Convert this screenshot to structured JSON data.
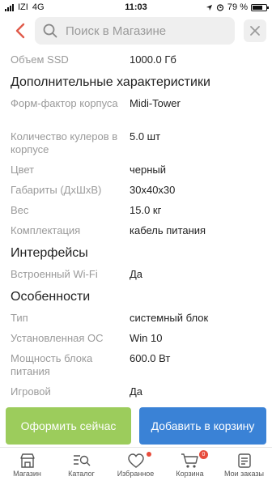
{
  "status_bar": {
    "carrier": "IZI",
    "network": "4G",
    "time": "11:03",
    "battery": "79 %",
    "battery_level": 0.79
  },
  "search": {
    "placeholder": "Поиск в Магазине"
  },
  "specs": {
    "top_row": {
      "key": "Объем SSD",
      "value": "1000.0 Гб"
    },
    "additional": {
      "title": "Дополнительные характеристики",
      "rows": [
        {
          "key": "Форм-фактор корпуса",
          "value": "Midi-Tower"
        },
        {
          "key": "Количество кулеров в корпусе",
          "value": "5.0 шт"
        },
        {
          "key": "Цвет",
          "value": "черный"
        },
        {
          "key": "Габариты (ДхШхВ)",
          "value": "30х40х30"
        },
        {
          "key": "Вес",
          "value": "15.0 кг"
        },
        {
          "key": "Комплектация",
          "value": "кабель питания"
        }
      ]
    },
    "interfaces": {
      "title": "Интерфейсы",
      "rows": [
        {
          "key": "Встроенный Wi-Fi",
          "value": "Да"
        }
      ]
    },
    "features": {
      "title": "Особенности",
      "rows": [
        {
          "key": "Тип",
          "value": "системный блок"
        },
        {
          "key": "Установленная ОС",
          "value": "Win 10"
        },
        {
          "key": "Мощность блока питания",
          "value": "600.0 Вт"
        },
        {
          "key": "Игровой",
          "value": "Да"
        }
      ]
    }
  },
  "actions": {
    "buy_now": "Оформить сейчас",
    "add_to_cart": "Добавить в корзину"
  },
  "tabbar": {
    "items": [
      {
        "label": "Магазин",
        "icon": "shop-icon"
      },
      {
        "label": "Каталог",
        "icon": "catalog-search-icon"
      },
      {
        "label": "Избранное",
        "icon": "heart-icon"
      },
      {
        "label": "Корзина",
        "icon": "cart-icon",
        "badge": "0"
      },
      {
        "label": "Мои заказы",
        "icon": "orders-icon"
      }
    ]
  },
  "colors": {
    "buy_button": "#9ccc5c",
    "cart_button": "#3a82d6",
    "accent_red": "#e74c3c"
  }
}
